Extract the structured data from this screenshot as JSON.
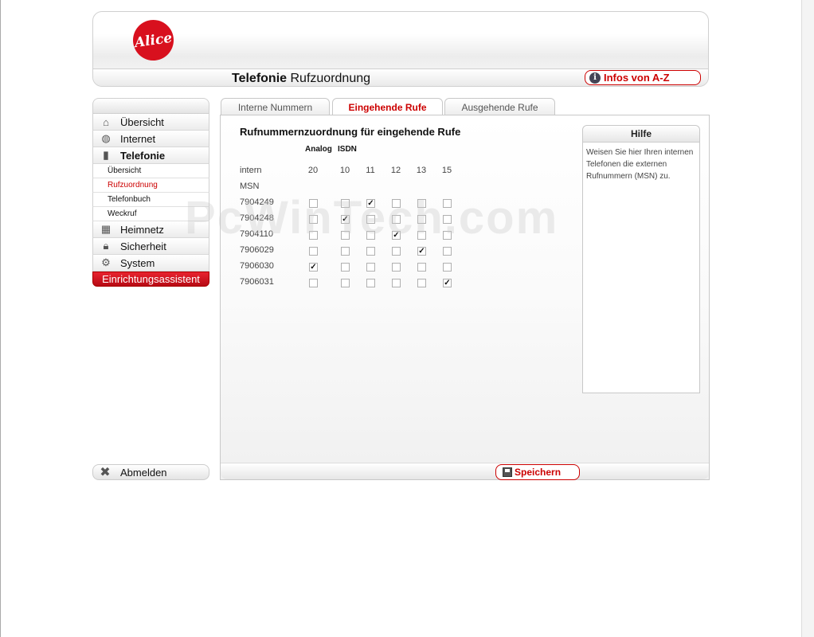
{
  "header": {
    "logo_text": "Alice",
    "title_bold": "Telefonie",
    "title_rest": "Rufzuordnung",
    "infos_button": "Infos von A-Z"
  },
  "sidebar": {
    "items": [
      {
        "label": "Übersicht",
        "icon": "house-icon"
      },
      {
        "label": "Internet",
        "icon": "globe-icon"
      },
      {
        "label": "Telefonie",
        "icon": "phone-icon",
        "active": true
      }
    ],
    "subitems": [
      {
        "label": "Übersicht"
      },
      {
        "label": "Rufzuordnung",
        "current": true
      },
      {
        "label": "Telefonbuch"
      },
      {
        "label": "Weckruf"
      }
    ],
    "items_after": [
      {
        "label": "Heimnetz",
        "icon": "network-icon"
      },
      {
        "label": "Sicherheit",
        "icon": "lock-icon"
      },
      {
        "label": "System",
        "icon": "gear-icon"
      }
    ],
    "wizard": "Einrichtungsassistent",
    "logout": "Abmelden"
  },
  "tabs": [
    {
      "label": "Interne Nummern"
    },
    {
      "label": "Eingehende Rufe",
      "active": true
    },
    {
      "label": "Ausgehende Rufe"
    }
  ],
  "main": {
    "title": "Rufnummernzuordnung für eingehende Rufe",
    "group_analog": "Analog",
    "group_isdn": "ISDN",
    "label_intern": "intern",
    "label_msn": "MSN",
    "columns": [
      "20",
      "10",
      "11",
      "12",
      "13",
      "15"
    ],
    "rows": [
      {
        "msn": "7904249",
        "checked": [
          false,
          false,
          true,
          false,
          false,
          false
        ]
      },
      {
        "msn": "7904248",
        "checked": [
          false,
          true,
          false,
          false,
          false,
          false
        ]
      },
      {
        "msn": "7904110",
        "checked": [
          false,
          false,
          false,
          true,
          false,
          false
        ]
      },
      {
        "msn": "7906029",
        "checked": [
          false,
          false,
          false,
          false,
          true,
          false
        ]
      },
      {
        "msn": "7906030",
        "checked": [
          true,
          false,
          false,
          false,
          false,
          false
        ]
      },
      {
        "msn": "7906031",
        "checked": [
          false,
          false,
          false,
          false,
          false,
          true
        ]
      }
    ],
    "save_button": "Speichern"
  },
  "help": {
    "title": "Hilfe",
    "text": "Weisen Sie hier Ihren internen Telefonen die externen Rufnummern (MSN) zu."
  },
  "watermark": "PcWinTech.com",
  "colors": {
    "accent": "#cc0000",
    "logo": "#d8101e"
  }
}
